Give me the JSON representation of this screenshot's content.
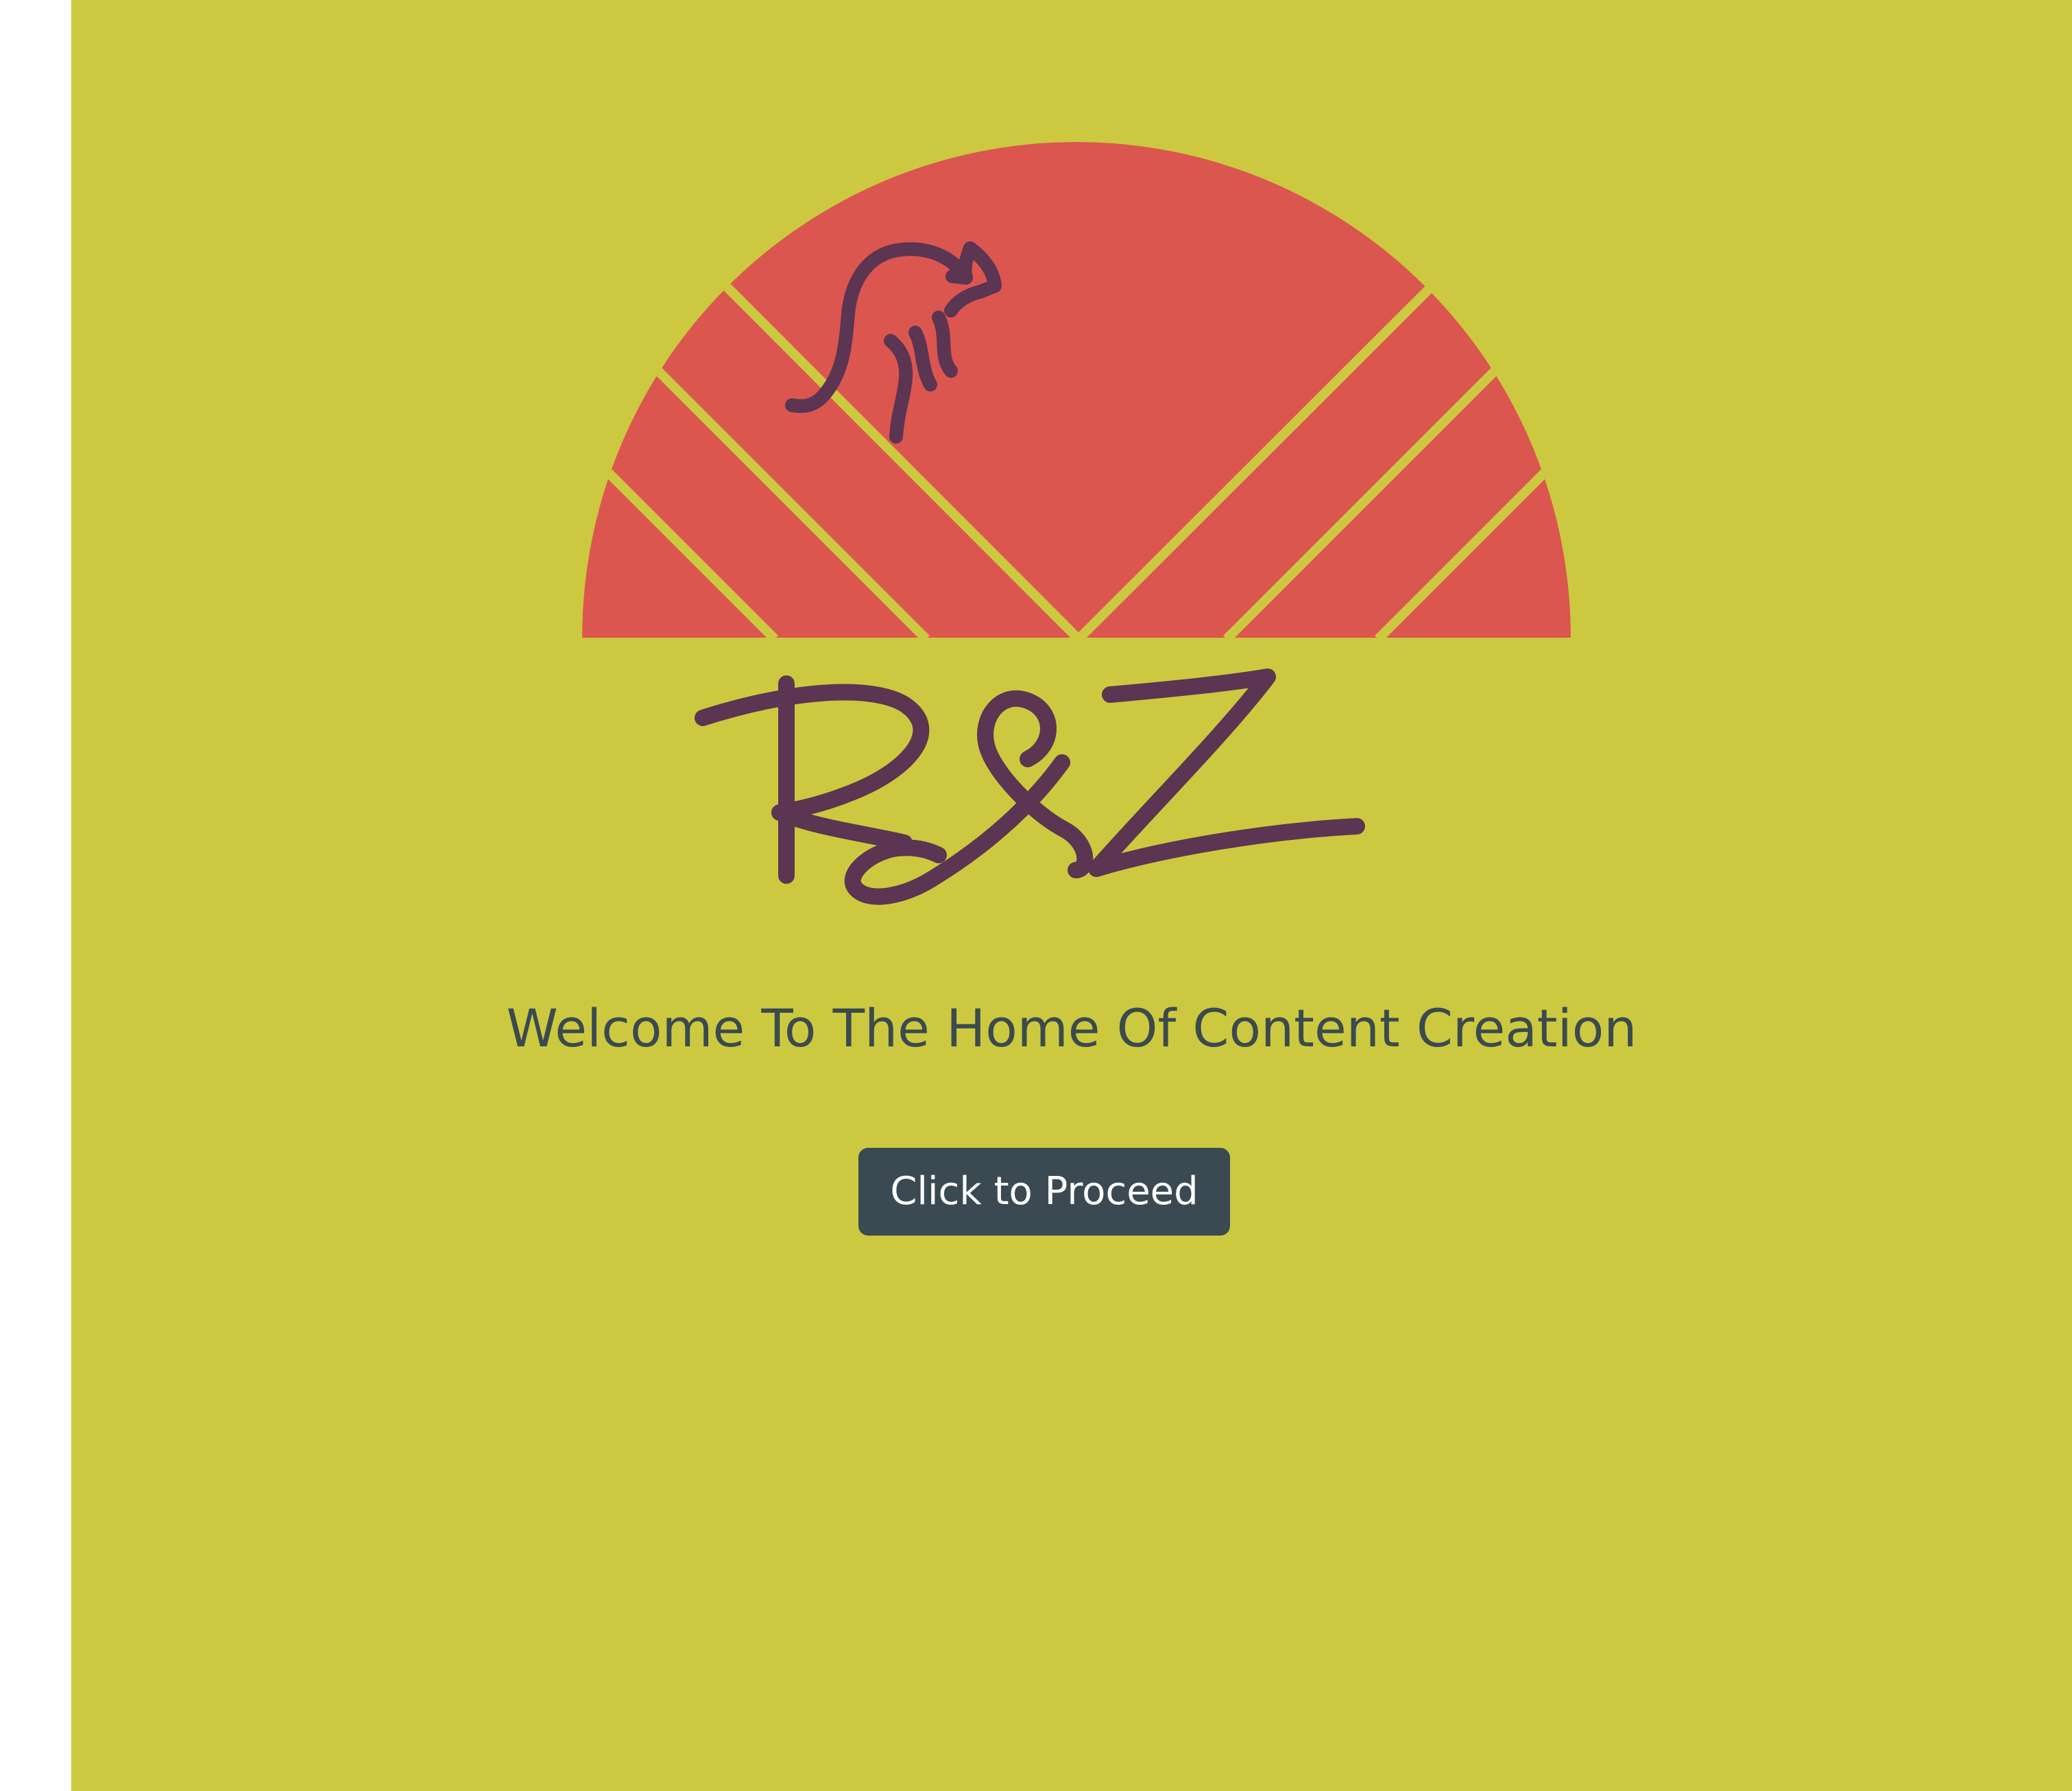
{
  "brand": {
    "logo_text": "R&Z",
    "logo_icon": "kangaroo-icon",
    "colors": {
      "background": "#ccc940",
      "sun": "#dc5650",
      "ink": "#5b3551",
      "button": "#3b4a52",
      "tagline": "#3a4a4e"
    }
  },
  "hero": {
    "tagline": "Welcome To The Home Of Content Creation",
    "proceed_label": "Click to Proceed"
  }
}
